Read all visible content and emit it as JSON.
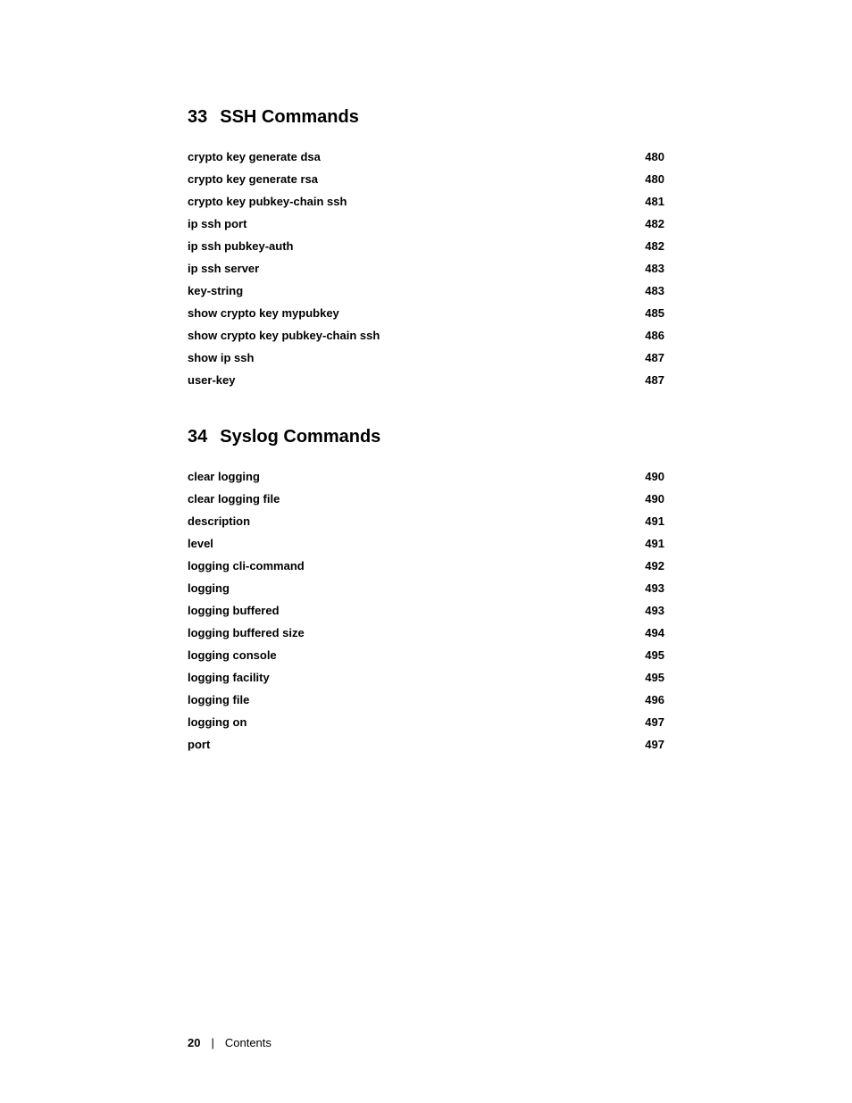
{
  "sections": [
    {
      "id": "ssh-commands",
      "number": "33",
      "title": "SSH Commands",
      "items": [
        {
          "label": "crypto key generate dsa",
          "page": "480"
        },
        {
          "label": "crypto key generate rsa",
          "page": "480"
        },
        {
          "label": "crypto key pubkey-chain ssh",
          "page": "481"
        },
        {
          "label": "ip ssh port",
          "page": "482"
        },
        {
          "label": "ip ssh pubkey-auth",
          "page": "482"
        },
        {
          "label": "ip ssh server",
          "page": "483"
        },
        {
          "label": "key-string",
          "page": "483"
        },
        {
          "label": "show crypto key mypubkey",
          "page": "485"
        },
        {
          "label": "show crypto key pubkey-chain ssh",
          "page": "486"
        },
        {
          "label": "show ip ssh",
          "page": "487"
        },
        {
          "label": "user-key",
          "page": "487"
        }
      ]
    },
    {
      "id": "syslog-commands",
      "number": "34",
      "title": "Syslog Commands",
      "items": [
        {
          "label": "clear logging",
          "page": "490"
        },
        {
          "label": "clear logging file",
          "page": "490"
        },
        {
          "label": "description",
          "page": "491"
        },
        {
          "label": "level",
          "page": "491"
        },
        {
          "label": "logging cli-command",
          "page": "492"
        },
        {
          "label": "logging",
          "page": "493"
        },
        {
          "label": "logging buffered",
          "page": "493"
        },
        {
          "label": "logging buffered size",
          "page": "494"
        },
        {
          "label": "logging console",
          "page": "495"
        },
        {
          "label": "logging facility",
          "page": "495"
        },
        {
          "label": "logging file",
          "page": "496"
        },
        {
          "label": "logging on",
          "page": "497"
        },
        {
          "label": "port",
          "page": "497"
        }
      ]
    }
  ],
  "footer": {
    "page_number": "20",
    "separator": "|",
    "label": "Contents"
  }
}
